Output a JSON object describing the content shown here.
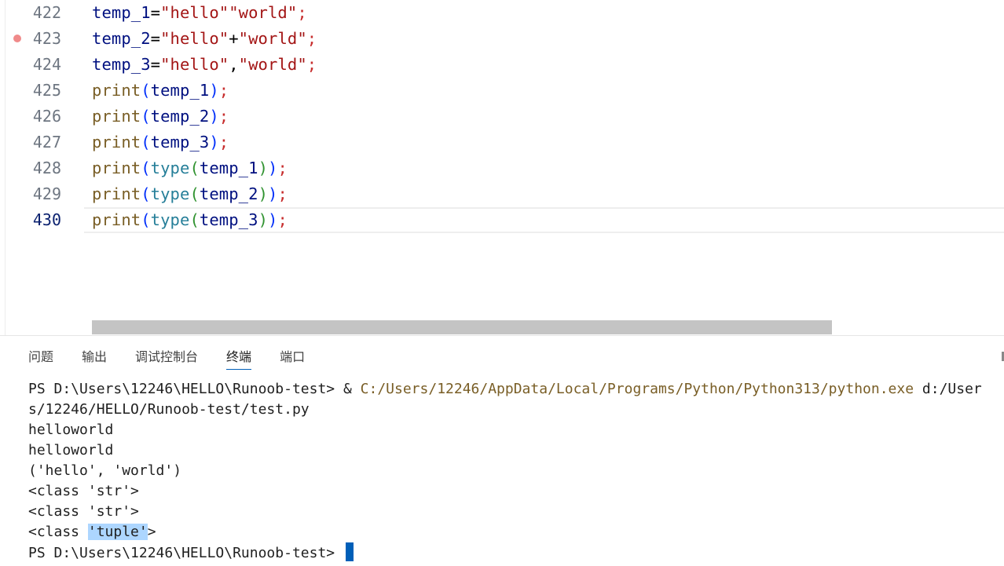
{
  "editor": {
    "lines": [
      {
        "num": "422",
        "code": [
          [
            "v",
            "temp_1"
          ],
          [
            "o",
            "="
          ],
          [
            "s",
            "\"hello\"\"world\""
          ],
          [
            "semi",
            ";"
          ]
        ]
      },
      {
        "num": "423",
        "breakpoint": true,
        "code": [
          [
            "v",
            "temp_2"
          ],
          [
            "o",
            "="
          ],
          [
            "s",
            "\"hello\""
          ],
          [
            "o",
            "+"
          ],
          [
            "s",
            "\"world\""
          ],
          [
            "semi",
            ";"
          ]
        ]
      },
      {
        "num": "424",
        "code": [
          [
            "v",
            "temp_3"
          ],
          [
            "o",
            "="
          ],
          [
            "s",
            "\"hello\""
          ],
          [
            "o",
            ","
          ],
          [
            "s",
            "\"world\""
          ],
          [
            "semi",
            ";"
          ]
        ]
      },
      {
        "num": "425",
        "code": [
          [
            "f",
            "print"
          ],
          [
            "p1",
            "("
          ],
          [
            "v",
            "temp_1"
          ],
          [
            "p1",
            ")"
          ],
          [
            "semi",
            ";"
          ]
        ]
      },
      {
        "num": "426",
        "code": [
          [
            "f",
            "print"
          ],
          [
            "p1",
            "("
          ],
          [
            "v",
            "temp_2"
          ],
          [
            "p1",
            ")"
          ],
          [
            "semi",
            ";"
          ]
        ]
      },
      {
        "num": "427",
        "code": [
          [
            "f",
            "print"
          ],
          [
            "p1",
            "("
          ],
          [
            "v",
            "temp_3"
          ],
          [
            "p1",
            ")"
          ],
          [
            "semi",
            ";"
          ]
        ]
      },
      {
        "num": "428",
        "code": [
          [
            "f",
            "print"
          ],
          [
            "p1",
            "("
          ],
          [
            "b",
            "type"
          ],
          [
            "p2",
            "("
          ],
          [
            "v",
            "temp_1"
          ],
          [
            "p2",
            ")"
          ],
          [
            "p1",
            ")"
          ],
          [
            "semi",
            ";"
          ]
        ]
      },
      {
        "num": "429",
        "code": [
          [
            "f",
            "print"
          ],
          [
            "p1",
            "("
          ],
          [
            "b",
            "type"
          ],
          [
            "p2",
            "("
          ],
          [
            "v",
            "temp_2"
          ],
          [
            "p2",
            ")"
          ],
          [
            "p1",
            ")"
          ],
          [
            "semi",
            ";"
          ]
        ]
      },
      {
        "num": "430",
        "active": true,
        "code": [
          [
            "f",
            "print"
          ],
          [
            "p1",
            "("
          ],
          [
            "b",
            "type"
          ],
          [
            "p2",
            "("
          ],
          [
            "v",
            "temp_3"
          ],
          [
            "p2",
            ")"
          ],
          [
            "p1",
            ")"
          ],
          [
            "semi",
            ";"
          ]
        ]
      }
    ]
  },
  "panel": {
    "tabs": [
      "问题",
      "输出",
      "调试控制台",
      "终端",
      "端口"
    ],
    "active_tab": "终端"
  },
  "terminal": {
    "prompt1": "PS D:\\Users\\12246\\HELLO\\Runoob-test> ",
    "amp": "& ",
    "exe_path": "C:/Users/12246/AppData/Local/Programs/Python/Python313/python.exe",
    "arg_part1": " d:/User",
    "arg_part2": "s/12246/HELLO/Runoob-test/test.py",
    "out1": "helloworld",
    "out2": "helloworld",
    "out3": "('hello', 'world')",
    "out4": "<class 'str'>",
    "out5": "<class 'str'>",
    "out6_pre": "<class ",
    "out6_sel": "'tuple'",
    "out6_post": ">",
    "prompt2": "PS D:\\Users\\12246\\HELLO\\Runoob-test> "
  },
  "colors": {
    "accent": "#005fb8",
    "breakpoint": "#f08a8a",
    "selection": "#add6ff"
  }
}
